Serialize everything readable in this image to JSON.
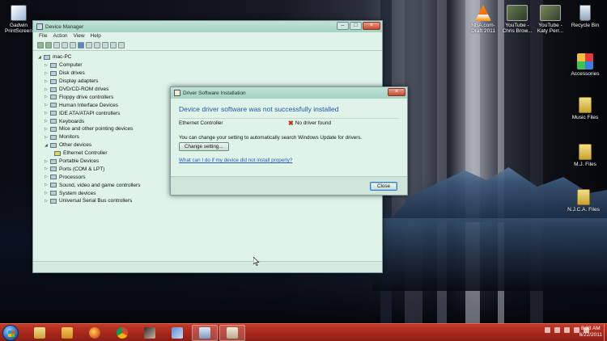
{
  "desktop": {
    "icons": [
      {
        "name": "gadwin-printscreen-icon",
        "line1": "Gadwin",
        "line2": "PrintScreen"
      },
      {
        "name": "nba-com-icon",
        "line1": "NBA.com-",
        "line2": "Draft 2011"
      },
      {
        "name": "youtube-chris-brown-icon",
        "line1": "YouTube -",
        "line2": "Chris Brow..."
      },
      {
        "name": "youtube-katy-perry-icon",
        "line1": "YouTube -",
        "line2": "Katy Perr..."
      },
      {
        "name": "recycle-bin-icon",
        "line1": "Recycle Bin",
        "line2": ""
      },
      {
        "name": "accessories-icon",
        "line1": "Accessories",
        "line2": ""
      },
      {
        "name": "music-files-icon",
        "line1": "Music Files",
        "line2": ""
      },
      {
        "name": "mj-files-icon",
        "line1": "M.J. Files",
        "line2": ""
      },
      {
        "name": "njca-files-icon",
        "line1": "N.J.C.A. Files",
        "line2": ""
      }
    ]
  },
  "device_manager": {
    "title": "Device Manager",
    "menu": [
      "File",
      "Action",
      "View",
      "Help"
    ],
    "tree": {
      "root": "mac-PC",
      "items": [
        "Computer",
        "Disk drives",
        "Display adapters",
        "DVD/CD-ROM drives",
        "Floppy drive controllers",
        "Human Interface Devices",
        "IDE ATA/ATAPI controllers",
        "Keyboards",
        "Mice and other pointing devices",
        "Monitors",
        "Other devices",
        "Ethernet Controller",
        "Portable Devices",
        "Ports (COM & LPT)",
        "Processors",
        "Sound, video and game controllers",
        "System devices",
        "Universal Serial Bus controllers"
      ]
    }
  },
  "driver_dialog": {
    "title": "Driver Software Installation",
    "heading": "Device driver software was not successfully installed",
    "device_name": "Ethernet Controller",
    "device_status": "No driver found",
    "info_text": "You can change your setting to automatically search Windows Update for drivers.",
    "change_button": "Change setting...",
    "help_link": "What can I do if my device did not install properly?",
    "close_button": "Close"
  },
  "taskbar": {
    "time": "8:33 AM",
    "date": "6/22/2011"
  }
}
